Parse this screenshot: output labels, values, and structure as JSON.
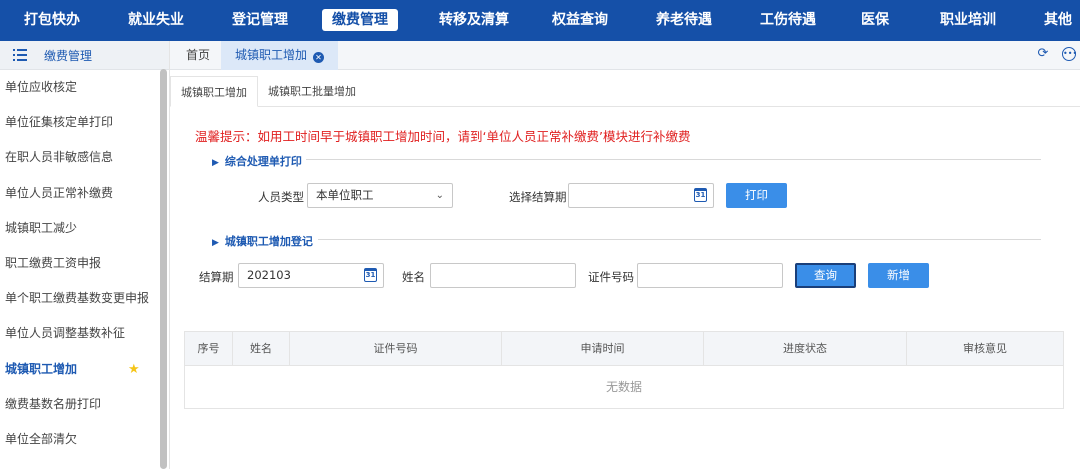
{
  "topnav": {
    "items": [
      "打包快办",
      "就业失业",
      "登记管理",
      "缴费管理",
      "转移及清算",
      "权益查询",
      "养老待遇",
      "工伤待遇",
      "医保",
      "职业培训",
      "其他"
    ],
    "active_index": 3
  },
  "sidebar": {
    "title": "缴费管理",
    "items": [
      "单位应收核定",
      "单位征集核定单打印",
      "在职人员非敏感信息",
      "单位人员正常补缴费",
      "城镇职工减少",
      "职工缴费工资申报",
      "单个职工缴费基数变更申报",
      "单位人员调整基数补征",
      "城镇职工增加",
      "缴费基数名册打印",
      "单位全部清欠"
    ],
    "active_index": 8
  },
  "tabs": {
    "home": "首页",
    "current": "城镇职工增加"
  },
  "subtabs": [
    "城镇职工增加",
    "城镇职工批量增加"
  ],
  "tip": "温馨提示：如用工时间早于城镇职工增加时间，请到‘单位人员正常补缴费’模块进行补缴费",
  "section1": {
    "title": "综合处理单打印",
    "person_type_label": "人员类型",
    "person_type_value": "本单位职工",
    "period_label": "选择结算期",
    "period_value": "",
    "print_button": "打印"
  },
  "section2": {
    "title": "城镇职工增加登记",
    "period_label": "结算期",
    "period_value": "202103",
    "name_label": "姓名",
    "name_value": "",
    "id_label": "证件号码",
    "id_value": "",
    "query_button": "查询",
    "add_button": "新增"
  },
  "table": {
    "columns": [
      "序号",
      "姓名",
      "证件号码",
      "申请时间",
      "进度状态",
      "审核意见"
    ],
    "empty_text": "无数据"
  },
  "calendar_day": "31",
  "colors": {
    "nav_bg": "#1550a8",
    "accent": "#1e5ab2",
    "button": "#3a8ee8",
    "tip": "#e02020"
  }
}
